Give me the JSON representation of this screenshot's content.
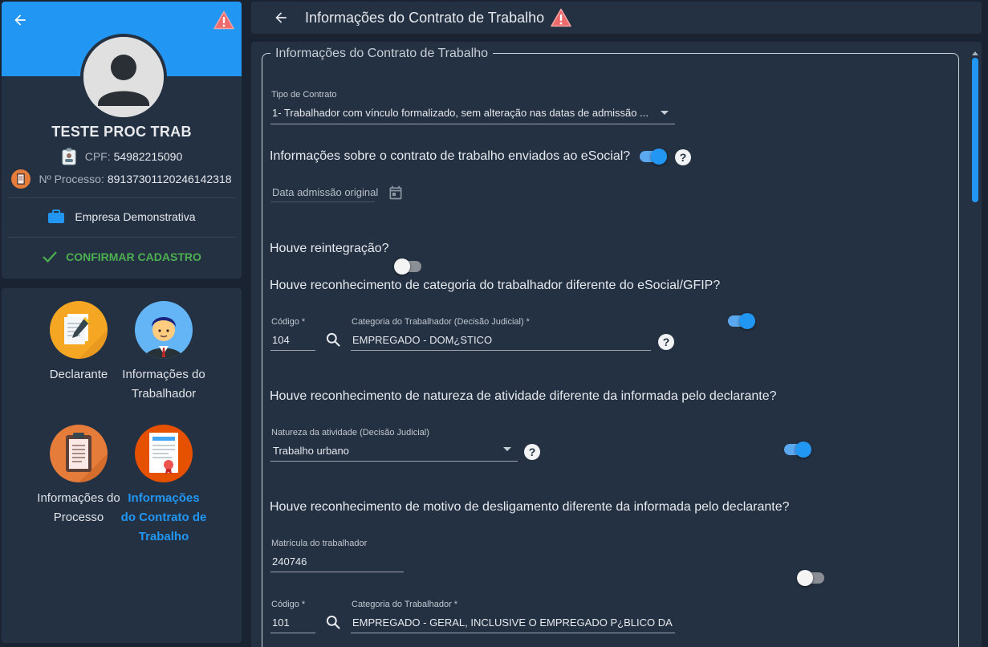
{
  "profile": {
    "name": "TESTE PROC TRAB",
    "cpf_label": "CPF:",
    "cpf": "54982215090",
    "process_label": "Nº Processo:",
    "process": "89137301120246142318",
    "company": "Empresa Demonstrativa",
    "confirm_label": "CONFIRMAR CADASTRO",
    "banner_color": "#2196f3",
    "confirm_color": "#4caf50"
  },
  "nav": {
    "items": [
      {
        "label": "Declarante",
        "icon": "document-pen-icon"
      },
      {
        "label": "Informações do Trabalhador",
        "icon": "worker-avatar-icon"
      },
      {
        "label": "Informações do Processo",
        "icon": "clipboard-icon"
      },
      {
        "label": "Informações do Contrato de Trabalho",
        "icon": "contract-certificate-icon",
        "active": true
      }
    ]
  },
  "header": {
    "title": "Informações do Contrato de Trabalho"
  },
  "form": {
    "legend": "Informações do Contrato de Trabalho",
    "tipo_contrato": {
      "label": "Tipo de Contrato",
      "value": "1- Trabalhador com vínculo formalizado, sem alteração nas datas de admissão ..."
    },
    "q_esocial": {
      "text": "Informações sobre o contrato de trabalho enviados ao eSocial?",
      "value": true
    },
    "data_admissao": {
      "placeholder": "Data admissão original"
    },
    "q_reintegracao": {
      "text": "Houve reintegração?",
      "value": false
    },
    "q_categoria": {
      "text": "Houve reconhecimento de categoria do trabalhador diferente do eSocial/GFIP?",
      "value": true
    },
    "codigo1": {
      "label": "Código *",
      "value": "104"
    },
    "categoria_judicial": {
      "label": "Categoria do Trabalhador (Decisão Judicial) *",
      "value": "EMPREGADO - DOM¿STICO"
    },
    "q_natureza": {
      "text": "Houve reconhecimento de natureza de atividade diferente da informada pelo declarante?",
      "value": true
    },
    "natureza": {
      "label": "Natureza da atividade (Decisão Judicial)",
      "value": "Trabalho urbano"
    },
    "q_desligamento": {
      "text": "Houve reconhecimento de motivo de desligamento diferente da informada pelo declarante?",
      "value": false
    },
    "matricula": {
      "label": "Matrícula do trabalhador",
      "value": "240746"
    },
    "codigo2": {
      "label": "Código *",
      "value": "101"
    },
    "categoria": {
      "label": "Categoria do Trabalhador *",
      "value": "EMPREGADO - GERAL, INCLUSIVE O EMPREGADO P¿BLICO DA ADMI"
    }
  },
  "colors": {
    "accent": "#2196f3",
    "background": "#1a2332",
    "panel": "#243142",
    "warning": "#ef5350"
  }
}
